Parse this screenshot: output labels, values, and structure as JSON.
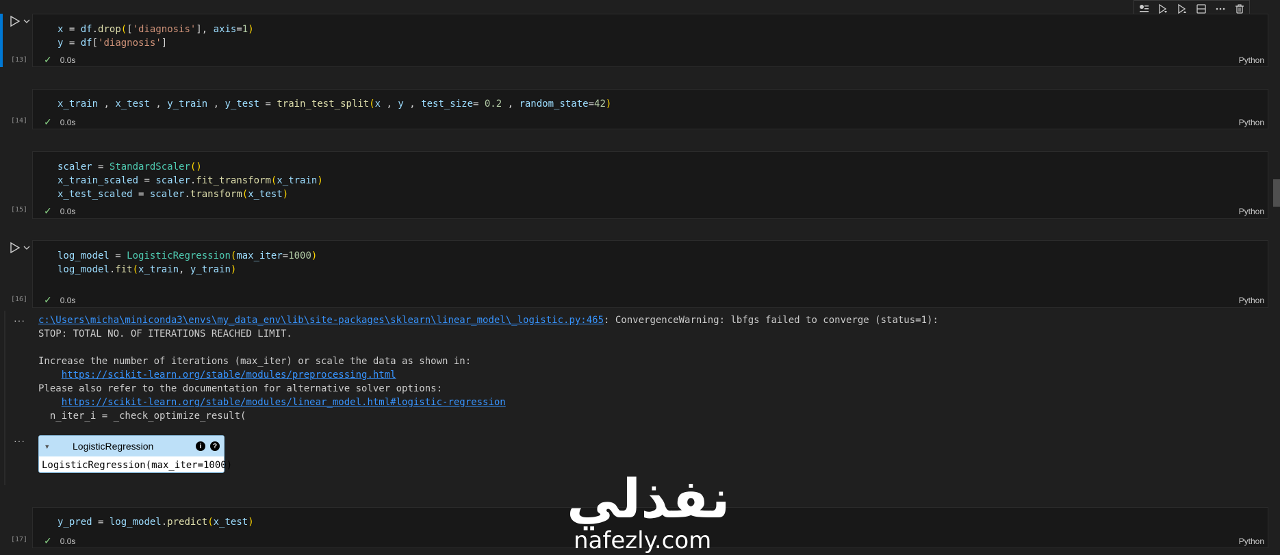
{
  "toolbar": {
    "icons": [
      "split-run-icon",
      "run-above-icon",
      "run-below-icon",
      "split-cell-icon",
      "more-icon",
      "delete-icon"
    ]
  },
  "cells": [
    {
      "exec": "[13]",
      "lines": [
        [
          [
            "var",
            "x"
          ],
          [
            "plain",
            " = "
          ],
          [
            "var",
            "df"
          ],
          [
            "plain",
            "."
          ],
          [
            "fn",
            "drop"
          ],
          [
            "par",
            "("
          ],
          [
            "plain",
            "["
          ],
          [
            "str",
            "'diagnosis'"
          ],
          [
            "plain",
            "], "
          ],
          [
            "var",
            "axis"
          ],
          [
            "plain",
            "="
          ],
          [
            "num",
            "1"
          ],
          [
            "par",
            ")"
          ]
        ],
        [
          [
            "var",
            "y"
          ],
          [
            "plain",
            " = "
          ],
          [
            "var",
            "df"
          ],
          [
            "plain",
            "["
          ],
          [
            "str",
            "'diagnosis'"
          ],
          [
            "plain",
            "]"
          ]
        ]
      ],
      "time": "0.0s",
      "lang": "Python"
    },
    {
      "exec": "[14]",
      "lines": [
        [
          [
            "var",
            "x_train"
          ],
          [
            "plain",
            " , "
          ],
          [
            "var",
            "x_test"
          ],
          [
            "plain",
            " , "
          ],
          [
            "var",
            "y_train"
          ],
          [
            "plain",
            " , "
          ],
          [
            "var",
            "y_test"
          ],
          [
            "plain",
            " = "
          ],
          [
            "fn",
            "train_test_split"
          ],
          [
            "par",
            "("
          ],
          [
            "var",
            "x"
          ],
          [
            "plain",
            " , "
          ],
          [
            "var",
            "y"
          ],
          [
            "plain",
            " , "
          ],
          [
            "var",
            "test_size"
          ],
          [
            "plain",
            "= "
          ],
          [
            "num",
            "0.2"
          ],
          [
            "plain",
            " , "
          ],
          [
            "var",
            "random_state"
          ],
          [
            "plain",
            "="
          ],
          [
            "num",
            "42"
          ],
          [
            "par",
            ")"
          ]
        ]
      ],
      "time": "0.0s",
      "lang": "Python"
    },
    {
      "exec": "[15]",
      "lines": [
        [
          [
            "var",
            "scaler"
          ],
          [
            "plain",
            " = "
          ],
          [
            "cls",
            "StandardScaler"
          ],
          [
            "par",
            "()"
          ]
        ],
        [
          [
            "var",
            "x_train_scaled"
          ],
          [
            "plain",
            " = "
          ],
          [
            "var",
            "scaler"
          ],
          [
            "plain",
            "."
          ],
          [
            "fn",
            "fit_transform"
          ],
          [
            "par",
            "("
          ],
          [
            "var",
            "x_train"
          ],
          [
            "par",
            ")"
          ]
        ],
        [
          [
            "var",
            "x_test_scaled"
          ],
          [
            "plain",
            " = "
          ],
          [
            "var",
            "scaler"
          ],
          [
            "plain",
            "."
          ],
          [
            "fn",
            "transform"
          ],
          [
            "par",
            "("
          ],
          [
            "var",
            "x_test"
          ],
          [
            "par",
            ")"
          ]
        ]
      ],
      "time": "0.0s",
      "lang": "Python"
    },
    {
      "exec": "[16]",
      "lines": [
        [
          [
            "var",
            "log_model"
          ],
          [
            "plain",
            " = "
          ],
          [
            "cls",
            "LogisticRegression"
          ],
          [
            "par",
            "("
          ],
          [
            "var",
            "max_iter"
          ],
          [
            "plain",
            "="
          ],
          [
            "num",
            "1000"
          ],
          [
            "par",
            ")"
          ]
        ],
        [
          [
            "var",
            "log_model"
          ],
          [
            "plain",
            "."
          ],
          [
            "fn",
            "fit"
          ],
          [
            "par",
            "("
          ],
          [
            "var",
            "x_train"
          ],
          [
            "plain",
            ", "
          ],
          [
            "var",
            "y_train"
          ],
          [
            "par",
            ")"
          ]
        ]
      ],
      "time": "0.0s",
      "lang": "Python"
    },
    {
      "exec": "[17]",
      "lines": [
        [
          [
            "var",
            "y_pred"
          ],
          [
            "plain",
            " = "
          ],
          [
            "var",
            "log_model"
          ],
          [
            "plain",
            "."
          ],
          [
            "fn",
            "predict"
          ],
          [
            "par",
            "("
          ],
          [
            "var",
            "x_test"
          ],
          [
            "par",
            ")"
          ]
        ]
      ],
      "time": "0.0s",
      "lang": "Python"
    }
  ],
  "output": {
    "path_link": "c:\\Users\\micha\\miniconda3\\envs\\my_data_env\\lib\\site-packages\\sklearn\\linear_model\\_logistic.py:465",
    "warning": ": ConvergenceWarning: lbfgs failed to converge (status=1):",
    "line2": "STOP: TOTAL NO. OF ITERATIONS REACHED LIMIT.",
    "line4": "Increase the number of iterations (max_iter) or scale the data as shown in:",
    "link1": "https://scikit-learn.org/stable/modules/preprocessing.html",
    "line6": "Please also refer to the documentation for alternative solver options:",
    "link2": "https://scikit-learn.org/stable/modules/linear_model.html#logistic-regression",
    "line8": "  n_iter_i = _check_optimize_result(",
    "dots": "···"
  },
  "estimator": {
    "title": "LogisticRegression",
    "repr": "LogisticRegression(max_iter=1000)",
    "info_glyph": "i",
    "help_glyph": "?",
    "toggle_glyph": "▾"
  },
  "watermark": {
    "arabic": "نفذلي",
    "latin": "nafezly.com"
  }
}
